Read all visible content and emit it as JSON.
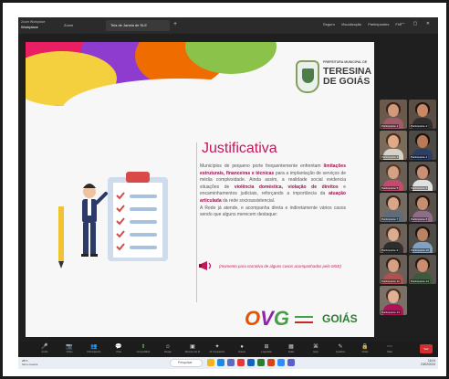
{
  "window": {
    "app_title": "Zoom Workplace",
    "app_name": "Workplace",
    "tab1": "Zoom",
    "tab2": "Tela de Janela de SLE",
    "right_items": [
      "Seguro",
      "Visualização",
      "Participantes",
      "Fim"
    ],
    "window_controls": "— ▢ ✕"
  },
  "slide": {
    "logo_small": "PREFEITURA MUNICIPAL DE",
    "logo_line1": "TERESINA",
    "logo_line2": "DE GOIÁS",
    "title": "Justificativa",
    "paragraph_1_a": "Municípios de pequeno porte frequentemente enfrentam ",
    "paragraph_1_b": "limitações estruturais, financeiras e técnicas",
    "paragraph_1_c": " para a implantação de serviços de média complexidade. Ainda assim, a realidade social evidencia situações de ",
    "paragraph_1_d": "violência doméstica, violação de direitos",
    "paragraph_1_e": " e encaminhamentos judiciais, reforçando a importância da ",
    "paragraph_1_f": "atuação articulada",
    "paragraph_1_g": " da rede socioassistencial.",
    "paragraph_2": "A Rede já atende, e acompanha direta e indiretamente vários casos sendo que alguns merecem destaque:",
    "footnote": "(momento para narrativa de alguns casos acompanhados pelo MSE)",
    "brand_logo": "OVG",
    "state_logo": "GOIÁS"
  },
  "participants": [
    {
      "name": "Participante 1"
    },
    {
      "name": "Participante 2"
    },
    {
      "name": "Participante 3"
    },
    {
      "name": "Participante 4"
    },
    {
      "name": "Participante 5"
    },
    {
      "name": "Participante 6"
    },
    {
      "name": "Participante 7"
    },
    {
      "name": "Participante 8"
    },
    {
      "name": "Participante 9"
    },
    {
      "name": "Participante 10"
    },
    {
      "name": "Participante 11"
    },
    {
      "name": "Participante 12"
    },
    {
      "name": "Participante 13"
    }
  ],
  "toolbar": {
    "items": [
      {
        "icon": "🎤",
        "label": "Áudio"
      },
      {
        "icon": "📷",
        "label": "Vídeo"
      },
      {
        "icon": "👥",
        "label": "Participantes"
      },
      {
        "icon": "💬",
        "label": "Chat"
      },
      {
        "icon": "⬆",
        "label": "Compartilhar"
      },
      {
        "icon": "☺",
        "label": "Reagir"
      },
      {
        "icon": "▣",
        "label": "Resumo de IA"
      },
      {
        "icon": "✦",
        "label": "AI Companion"
      },
      {
        "icon": "●",
        "label": "Gravar"
      },
      {
        "icon": "⊞",
        "label": "Legendas"
      },
      {
        "icon": "▦",
        "label": "Salas"
      },
      {
        "icon": "⌘",
        "label": "Apps"
      },
      {
        "icon": "✎",
        "label": "Quadros"
      },
      {
        "icon": "🔒",
        "label": "Notas"
      },
      {
        "icon": "⋯",
        "label": "Mais"
      }
    ],
    "leave_label": "Sair"
  },
  "taskbar": {
    "weather_temp": "28°C",
    "weather_desc": "Sol e nuvens",
    "search_placeholder": "Pesquisar",
    "time": "16:04",
    "date": "23/02/2024"
  },
  "colors": {
    "accent": "#c2185b",
    "toolbar_bg": "#1c1c1c",
    "leave": "#d32f2f"
  }
}
